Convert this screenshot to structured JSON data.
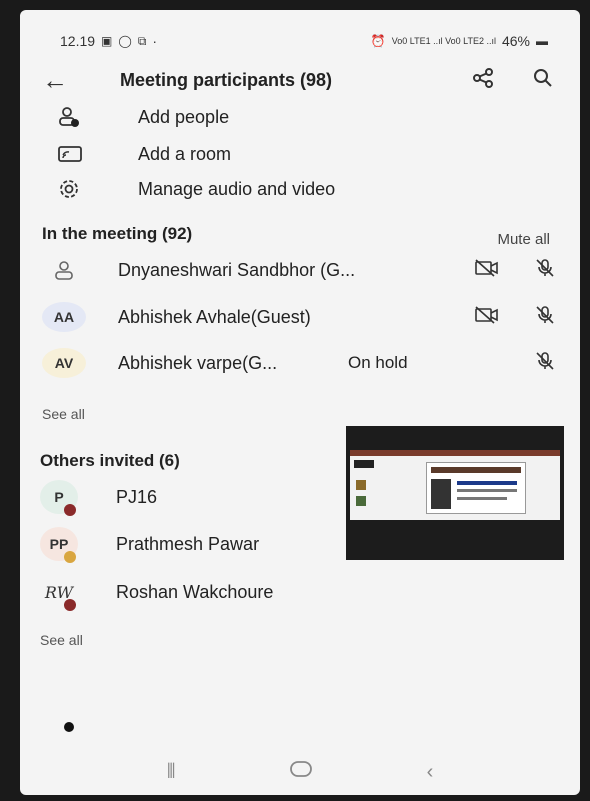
{
  "status_bar": {
    "time": "12.19",
    "battery": "46%",
    "network": "Vo0 LTE1 ..ıl Vo0 LTE2 ..ıl"
  },
  "header": {
    "title": "Meeting participants (98)"
  },
  "actions": [
    {
      "label": "Add people",
      "icon": "add-person-icon"
    },
    {
      "label": "Add a room",
      "icon": "cast-room-icon"
    },
    {
      "label": "Manage audio and video",
      "icon": "gear-icon"
    }
  ],
  "in_meeting": {
    "title": "In the meeting (92)",
    "mute_all": "Mute all",
    "participants": [
      {
        "initials": "",
        "name": "Dnyaneshwari Sandbhor (G...",
        "status": "",
        "avatar_color": "#f4f4f4"
      },
      {
        "initials": "AA",
        "name": "Abhishek Avhale(Guest)",
        "status": "",
        "avatar_color": "#e4e8f5"
      },
      {
        "initials": "AV",
        "name": "Abhishek varpe(G...",
        "status": "On hold",
        "avatar_color": "#f7f0d9"
      }
    ],
    "see_all": "See all"
  },
  "others_invited": {
    "title": "Others invited (6)",
    "people": [
      {
        "initials": "P",
        "name": "PJ16",
        "avatar_color": "#e3efe9",
        "dot_color": "#8a2a2a"
      },
      {
        "initials": "PP",
        "name": "Prathmesh Pawar",
        "avatar_color": "#f6e6e0",
        "dot_color": "#d9a640"
      },
      {
        "initials": "RW",
        "name": "Roshan Wakchoure",
        "avatar_color": "#f4f4f4",
        "dot_color": "#8a2a2a"
      }
    ],
    "see_all": "See all"
  },
  "colors": {
    "background": "#f4f4f4",
    "text": "#222222",
    "busy_dot": "#8a2a2a",
    "away_dot": "#d9a640"
  }
}
